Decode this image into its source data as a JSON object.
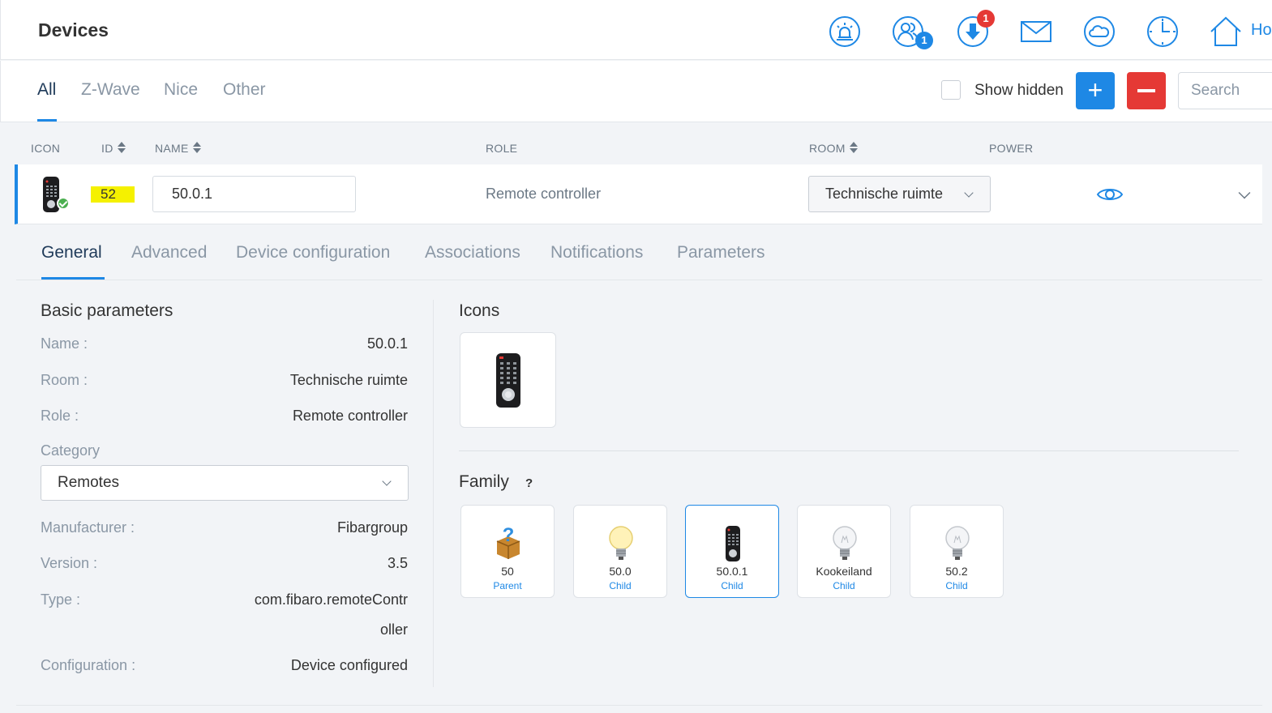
{
  "header": {
    "title": "Devices",
    "icons": [
      {
        "name": "alarm-icon"
      },
      {
        "name": "users-icon",
        "badge": "1"
      },
      {
        "name": "download-icon",
        "badge": "1"
      },
      {
        "name": "mail-icon"
      },
      {
        "name": "weather-icon"
      },
      {
        "name": "clock-icon"
      },
      {
        "name": "home-icon"
      }
    ],
    "home_label": "Ho"
  },
  "filters": {
    "tabs": [
      "All",
      "Z-Wave",
      "Nice",
      "Other"
    ],
    "active_tab": "All",
    "show_hidden_label": "Show hidden",
    "show_hidden_checked": false,
    "add_label": "+",
    "search_placeholder": "Search"
  },
  "table": {
    "columns": [
      "ICON",
      "ID",
      "NAME",
      "ROLE",
      "ROOM",
      "POWER"
    ]
  },
  "device": {
    "id": "52",
    "name": "50.0.1",
    "role": "Remote controller",
    "room": "Technische ruimte",
    "status": "ok"
  },
  "detail": {
    "tabs": [
      "General",
      "Advanced",
      "Device configuration",
      "Associations",
      "Notifications",
      "Parameters"
    ],
    "active_tab": "General",
    "basic": {
      "title": "Basic parameters",
      "name_label": "Name :",
      "name_value": "50.0.1",
      "room_label": "Room :",
      "room_value": "Technische ruimte",
      "role_label": "Role :",
      "role_value": "Remote controller",
      "category_label": "Category",
      "category_value": "Remotes",
      "manufacturer_label": "Manufacturer :",
      "manufacturer_value": "Fibargroup",
      "version_label": "Version :",
      "version_value": "3.5",
      "type_label": "Type :",
      "type_value_1": "com.fibaro.remoteContr",
      "type_value_2": "oller",
      "configuration_label": "Configuration :",
      "configuration_value": "Device configured"
    },
    "icons_title": "Icons",
    "family": {
      "title": "Family",
      "help": "?",
      "members": [
        {
          "name": "50",
          "relation": "Parent",
          "icon": "unknown-box-icon"
        },
        {
          "name": "50.0",
          "relation": "Child",
          "icon": "bulb-on-icon"
        },
        {
          "name": "50.0.1",
          "relation": "Child",
          "icon": "remote-icon",
          "selected": true
        },
        {
          "name": "Kookeiland",
          "relation": "Child",
          "icon": "bulb-off-icon"
        },
        {
          "name": "50.2",
          "relation": "Child",
          "icon": "bulb-off-icon"
        }
      ]
    }
  },
  "colors": {
    "accent": "#1e88e5",
    "danger": "#e53935",
    "id_highlight": "#f5f100",
    "ok": "#4caf50"
  }
}
